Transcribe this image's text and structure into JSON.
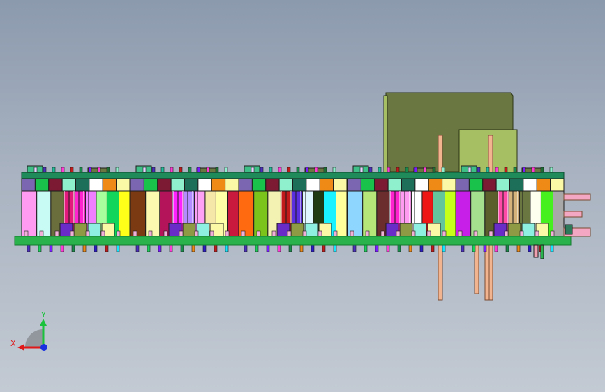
{
  "colors": {
    "board": "#2ab24c",
    "board_edge": "#137a2f",
    "rail": "#1f8a5a",
    "rail_edge": "#0b4b2f",
    "housing": "#6a7740",
    "housing_light": "#a6bf63",
    "housing_edge": "#2c3414",
    "pin": "#f2b48f",
    "pin_edge": "#7a4b33",
    "outline": "#1c1c1c"
  },
  "module": {
    "row1": [
      "#7b66b2",
      "#19c24a",
      "#7c1a33",
      "#8ef0cc",
      "#1d6f5a",
      "#ffffff",
      "#ee8a15",
      "#fbf9a5"
    ],
    "cells": [
      [
        "#ff9cf1",
        "#c8fbf3",
        "#6a6d3c",
        "#e41a7d",
        "#ff22cf",
        "#f080ff",
        "#a6ff9c",
        "#12d65b",
        "#ffff1a"
      ],
      [
        "#7b3a12",
        "#fbf8b0",
        "#b3145a",
        "#ff22ff",
        "#b48cff",
        "#ffa0f7",
        "#f4e7a8",
        "#ffffa8",
        "#c9193c"
      ],
      [
        "#ff6a10",
        "#7bc41b",
        "#f4f2b2",
        "#c21a1a",
        "#5a2fe0",
        "#e0f7ff",
        "#1f3b12",
        "#1af3ff",
        "#ffff9c"
      ],
      [
        "#8fd6ff",
        "#b6e67a",
        "#6b2d2d",
        "#ff22cf",
        "#ff9cf1",
        "#ffffff",
        "#ee1515",
        "#63c59b",
        "#c6ff1a"
      ],
      [
        "#c71ee8",
        "#a5e08f",
        "#5a5f2c",
        "#ff4aa8",
        "#d4b27a",
        "#6a7740",
        "#fffff0",
        "#46f01f",
        "#a8a8a8"
      ]
    ],
    "bottom": [
      "#6a2cc8",
      "#8f9a45",
      "#8ef0e0",
      "#fbf9a5"
    ],
    "top_pins": [
      "#e3d4ff",
      "#4a2fbf",
      "#1fbf9a",
      "#ff3bd5",
      "#c21a1a",
      "#1a8a4a",
      "#7a1aff",
      "#ff3bd5",
      "#1c6c34",
      "#8ef0cc"
    ],
    "bottom_pins": [
      "#4a2fbf",
      "#1ad05a",
      "#7a1aff",
      "#ff3bd5",
      "#1a8a4a",
      "#ee8a15",
      "#2a1ac8",
      "#c21a1a",
      "#14e6ff"
    ]
  },
  "axes": {
    "x_label": "X",
    "y_label": "Y"
  }
}
